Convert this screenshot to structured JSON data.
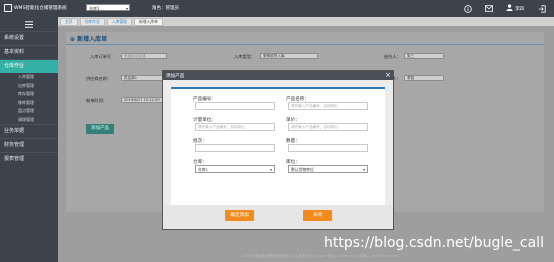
{
  "app": {
    "title": "WMS智能化仓储管理系统",
    "warehouse_selected": "仓库1",
    "role_label": "角色：",
    "role_value": "管理员",
    "user_name": "李四"
  },
  "icons": {
    "logo": "logo-icon",
    "info": "info-icon",
    "mail": "mail-icon",
    "user": "user-icon",
    "logout": "logout-icon",
    "menu": "menu-toggle-icon"
  },
  "sidebar": {
    "items": [
      {
        "label": "系统设置"
      },
      {
        "label": "基本资料"
      },
      {
        "label": "仓库作业"
      }
    ],
    "sub_items": [
      {
        "label": "入库管理"
      },
      {
        "label": "出库管理"
      },
      {
        "label": "库存管理"
      },
      {
        "label": "移库管理"
      },
      {
        "label": "盘点管理"
      },
      {
        "label": "调拨管理"
      }
    ],
    "items_after": [
      {
        "label": "业务单据"
      },
      {
        "label": "财务管理"
      },
      {
        "label": "报表管理"
      }
    ]
  },
  "breadcrumb": {
    "items": [
      "主页",
      "仓库作业",
      "入库管理",
      "新增入库单"
    ]
  },
  "page": {
    "title": "新增入库单",
    "fields": {
      "order_no_label": "入库订单号：",
      "order_no_placeholder": "系统自动生成",
      "type_label": "入库类型：",
      "type_value": "采购收货入库",
      "handler_label": "经办人：",
      "handler_value": "张三",
      "supplier_label": "供应商名称：",
      "supplier_value": "供应商1",
      "operator_label": "制单人：",
      "operator_value": "李四",
      "time_label": "制单时间：",
      "time_value": "2019/6/27 15:12:59"
    },
    "add_product_button": "添加产品"
  },
  "modal": {
    "title": "添加产品",
    "close_glyph": "×",
    "fields": {
      "code_label": "产品编号：",
      "code_placeholder": "",
      "name_label": "产品名称：",
      "name_placeholder": "请先输入产品编号，自动带出",
      "unit_label": "计量单位：",
      "unit_placeholder": "请先输入产品编号，自动带出",
      "price_label": "单价：",
      "price_placeholder": "请先输入产品编号，自动带出",
      "spec_label": "批次：",
      "spec_placeholder": "",
      "qty_label": "数量：",
      "qty_placeholder": "",
      "warehouse_label": "仓库：",
      "warehouse_value": "仓库1",
      "location_label": "库位：",
      "location_value": "默认货物库位"
    },
    "confirm_button": "确定添加",
    "close_button": "关闭"
  },
  "footer": {
    "text": "2019年度智能仓储管理系统V1.0 | 技术支持：bugle 电话：xxxx-xxxx | 邮箱：xxxx@xxx.com"
  },
  "watermark": "https://blog.csdn.net/bugle_call",
  "colors": {
    "topbar": "#3c434d",
    "accent_teal": "#35b0a6",
    "modal_header": "#4a4f57",
    "button_orange": "#f28b1c",
    "title_blue": "#2b7ab8"
  }
}
